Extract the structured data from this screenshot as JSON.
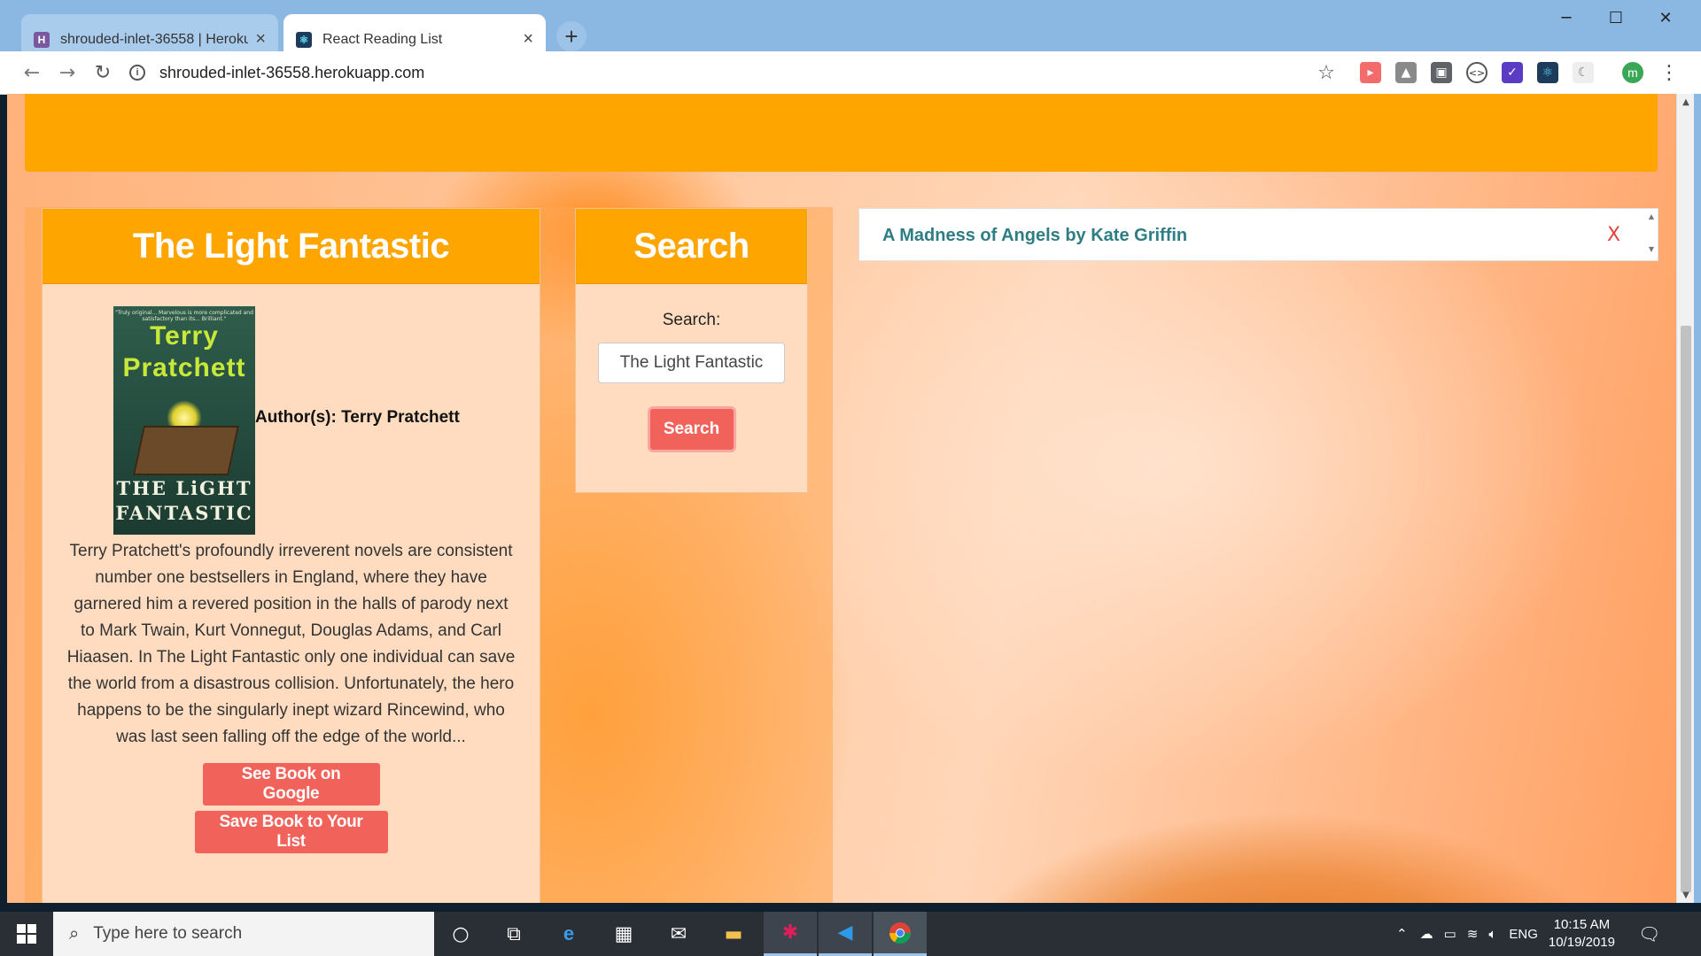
{
  "browser": {
    "tabs": [
      {
        "label": "shrouded-inlet-36558 | Heroku",
        "favicon": "heroku-icon",
        "active": false
      },
      {
        "label": "React Reading List",
        "favicon": "react-icon",
        "active": true
      }
    ],
    "new_tab_label": "+",
    "url": "shrouded-inlet-36558.herokuapp.com",
    "profile_initial": "m"
  },
  "book_card": {
    "title": "The Light Fantastic",
    "cover": {
      "blurb": "\"Truly original... Marvelous is more complicated and satisfactory than its... Brilliant.\"",
      "author_text": "Terry Pratchett",
      "title_text": "THE LiGHT FANTASTIC"
    },
    "author_line": "Author(s): Terry Pratchett",
    "description": "Terry Pratchett's profoundly irreverent novels are consistent number one bestsellers in England, where they have garnered him a revered position in the halls of parody next to Mark Twain, Kurt Vonnegut, Douglas Adams, and Carl Hiaasen. In The Light Fantastic only one individual can save the world from a disastrous collision. Unfortunately, the hero happens to be the singularly inept wizard Rincewind, who was last seen falling off the edge of the world...",
    "google_button": "See Book on Google",
    "save_button": "Save Book to Your List"
  },
  "search_card": {
    "title": "Search",
    "label": "Search:",
    "input_value": "The Light Fantastic",
    "button": "Search"
  },
  "reading_list": {
    "items": [
      {
        "text": "A Madness of Angels by Kate Griffin",
        "remove": "X"
      }
    ]
  },
  "taskbar": {
    "search_placeholder": "Type here to search",
    "language": "ENG",
    "time": "10:15 AM",
    "date": "10/19/2019"
  },
  "colors": {
    "banner": "#ffa500",
    "card_header": "#ffa500",
    "card_body": "#ffdcbf",
    "button": "#f0625a",
    "list_text": "#2e7d84",
    "remove_x": "#e0453c"
  }
}
